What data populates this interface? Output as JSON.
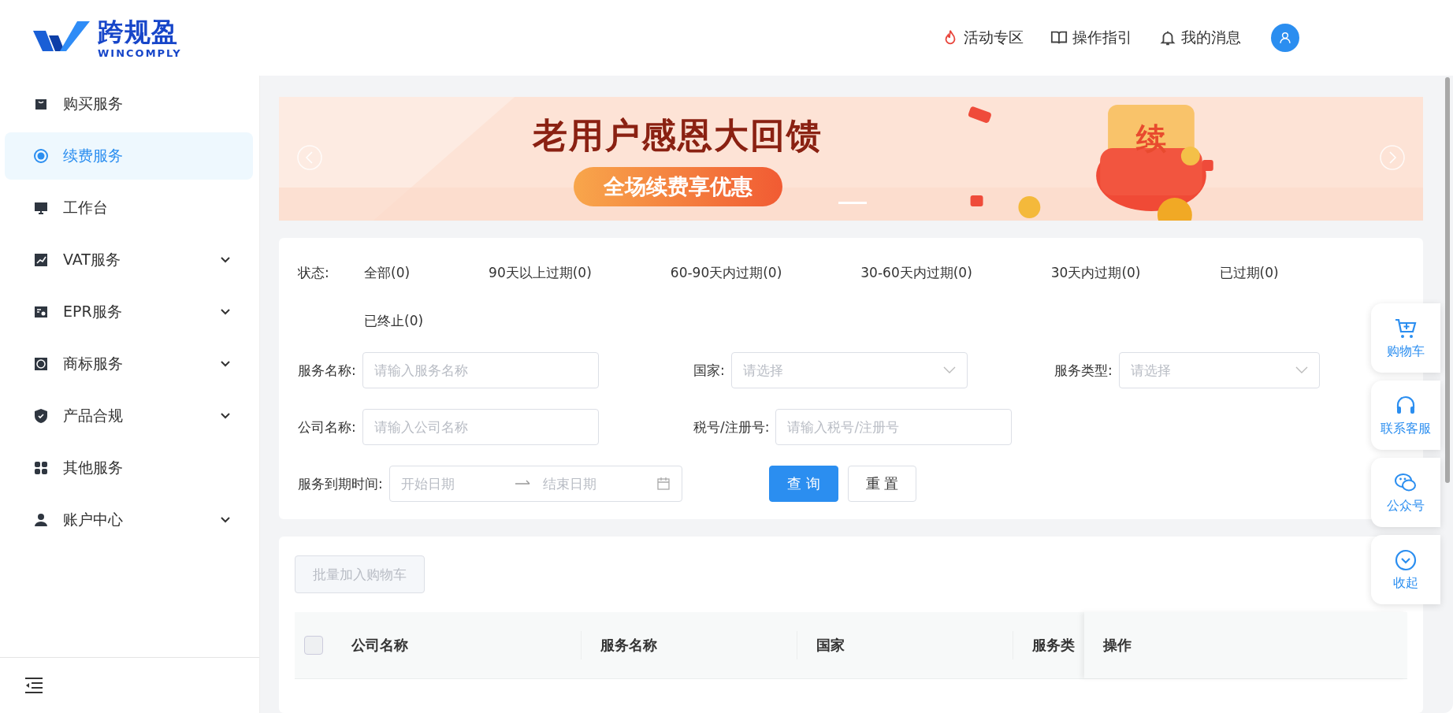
{
  "logo": {
    "name": "跨规盈",
    "sub": "WINCOMPLY"
  },
  "header_links": [
    {
      "kind": "fire",
      "label": "活动专区"
    },
    {
      "kind": "book",
      "label": "操作指引"
    },
    {
      "kind": "bell",
      "label": "我的消息"
    }
  ],
  "sidebar": {
    "items": [
      {
        "label": "购买服务",
        "selected": false,
        "expandable": false
      },
      {
        "label": "续费服务",
        "selected": true,
        "expandable": false
      },
      {
        "label": "工作台",
        "selected": false,
        "expandable": false
      },
      {
        "label": "VAT服务",
        "selected": false,
        "expandable": true
      },
      {
        "label": "EPR服务",
        "selected": false,
        "expandable": true
      },
      {
        "label": "商标服务",
        "selected": false,
        "expandable": true
      },
      {
        "label": "产品合规",
        "selected": false,
        "expandable": true
      },
      {
        "label": "其他服务",
        "selected": false,
        "expandable": false
      },
      {
        "label": "账户中心",
        "selected": false,
        "expandable": true
      }
    ]
  },
  "banner": {
    "title": "老用户感恩大回馈",
    "subtitle": "全场续费享优惠",
    "badge": "续"
  },
  "status_filter": {
    "label": "状态:",
    "options": [
      {
        "label": "全部(0)",
        "selected": false
      },
      {
        "label": "90天以上过期(0)",
        "selected": false
      },
      {
        "label": "60-90天内过期(0)",
        "selected": false
      },
      {
        "label": "30-60天内过期(0)",
        "selected": false
      },
      {
        "label": "30天内过期(0)",
        "selected": false
      },
      {
        "label": "已过期(0)",
        "selected": false
      },
      {
        "label": "已终止(0)",
        "selected": false
      }
    ]
  },
  "form": {
    "fields": [
      {
        "kind": "input",
        "label": "服务名称:",
        "placeholder": "请输入服务名称"
      },
      {
        "kind": "select",
        "label": "国家:",
        "placeholder": "请选择"
      },
      {
        "kind": "select",
        "label": "服务类型:",
        "placeholder": "请选择"
      },
      {
        "kind": "input",
        "label": "公司名称:",
        "placeholder": "请输入公司名称"
      },
      {
        "kind": "input",
        "label": "税号/注册号:",
        "placeholder": "请输入税号/注册号"
      }
    ],
    "date_range": {
      "label": "服务到期时间:",
      "start_placeholder": "开始日期",
      "end_placeholder": "结束日期"
    },
    "buttons": [
      {
        "kind": "primary",
        "label": "查 询"
      },
      {
        "kind": "default",
        "label": "重 置"
      }
    ]
  },
  "batch_button": {
    "label": "批量加入购物车",
    "disabled": true
  },
  "table": {
    "select_all_checked": false,
    "columns": [
      "公司名称",
      "服务名称",
      "国家",
      "服务类",
      "操作"
    ]
  },
  "float_tools": [
    {
      "label": "购物车"
    },
    {
      "label": "联系客服"
    },
    {
      "label": "公众号"
    },
    {
      "label": "收起"
    }
  ]
}
